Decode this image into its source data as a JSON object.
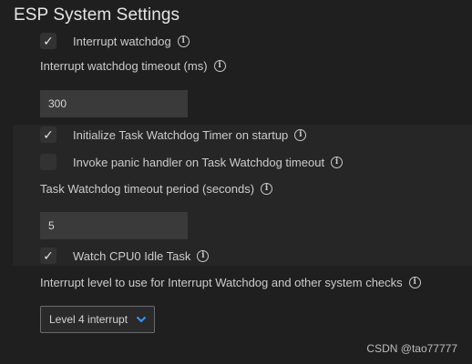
{
  "page": {
    "title": "ESP System Settings"
  },
  "settings": {
    "interrupt_watchdog": {
      "label": "Interrupt watchdog",
      "checked": true,
      "check_glyph": "✓"
    },
    "interrupt_watchdog_timeout": {
      "label": "Interrupt watchdog timeout (ms)",
      "value": "300"
    },
    "init_task_watchdog": {
      "label": "Initialize Task Watchdog Timer on startup",
      "checked": true,
      "check_glyph": "✓"
    },
    "invoke_panic": {
      "label": "Invoke panic handler on Task Watchdog timeout",
      "checked": false
    },
    "task_watchdog_timeout": {
      "label": "Task Watchdog timeout period (seconds)",
      "value": "5"
    },
    "watch_cpu0_idle": {
      "label": "Watch CPU0 Idle Task",
      "checked": true,
      "check_glyph": "✓"
    },
    "interrupt_level": {
      "label": "Interrupt level to use for Interrupt Watchdog and other system checks",
      "selected": "Level 4 interrupt"
    }
  },
  "icons": {
    "info_glyph": "i"
  },
  "watermark": "CSDN @tao77777",
  "colors": {
    "background": "#1f1f1f",
    "band": "#262626",
    "input_bg": "#3a3a3a",
    "accent": "#3794ff"
  }
}
